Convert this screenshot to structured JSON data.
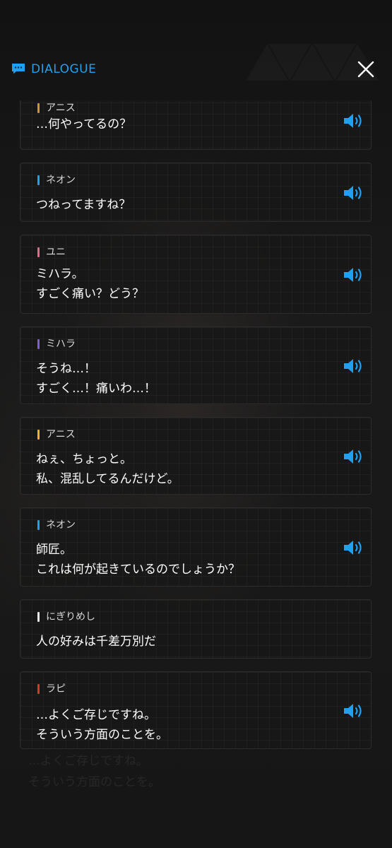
{
  "header": {
    "title": "DIALOGUE",
    "icon": "chat-bubble-icon",
    "close_icon": "close-icon"
  },
  "colors": {
    "accent": "#1ea1f2",
    "card_bg": "#181818",
    "text": "#ffffff",
    "speaker_text": "#d8d8d8"
  },
  "dialogue": [
    {
      "speaker": "アニス",
      "color": "#c79a2e",
      "lines": [
        "…何やってるの？"
      ],
      "voice": true
    },
    {
      "speaker": "ネオン",
      "color": "#1ea1f2",
      "lines": [
        "つねってますね？"
      ],
      "voice": true
    },
    {
      "speaker": "ユニ",
      "color": "#e8688c",
      "lines": [
        "ミハラ。",
        "すごく痛い？どう？"
      ],
      "voice": true
    },
    {
      "speaker": "ミハラ",
      "color": "#7f5fd8",
      "lines": [
        "そうね…！",
        "すごく…！痛いわ…！"
      ],
      "voice": true
    },
    {
      "speaker": "アニス",
      "color": "#f0b42c",
      "lines": [
        "ねぇ、ちょっと。",
        "私、混乱してるんだけど。"
      ],
      "voice": true
    },
    {
      "speaker": "ネオン",
      "color": "#1ea1f2",
      "lines": [
        "師匠。",
        "これは何が起きているのでしょうか？"
      ],
      "voice": true
    },
    {
      "speaker": "にぎりめし",
      "color": "#e8e8e8",
      "lines": [
        "人の好みは千差万別だ"
      ],
      "voice": false
    },
    {
      "speaker": "ラピ",
      "color": "#d23a2a",
      "lines": [
        "…よくご存じですね。",
        "そういう方面のことを。"
      ],
      "voice": true
    }
  ],
  "ghost_subtitle": [
    "…よくご存じですね。",
    "そういう方面のことを。"
  ]
}
